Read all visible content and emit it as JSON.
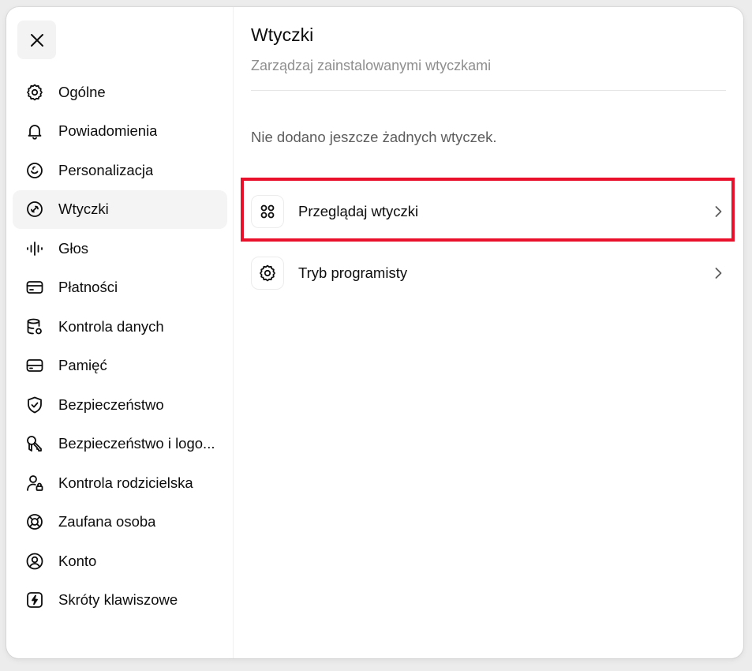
{
  "sidebar": {
    "close_icon": "close-icon",
    "items": [
      {
        "label": "Ogólne",
        "icon": "gear-icon"
      },
      {
        "label": "Powiadomienia",
        "icon": "bell-icon"
      },
      {
        "label": "Personalizacja",
        "icon": "smile-icon"
      },
      {
        "label": "Wtyczki",
        "icon": "plugin-icon",
        "active": true
      },
      {
        "label": "Głos",
        "icon": "voice-icon"
      },
      {
        "label": "Płatności",
        "icon": "card-icon"
      },
      {
        "label": "Kontrola danych",
        "icon": "database-icon"
      },
      {
        "label": "Pamięć",
        "icon": "memory-icon"
      },
      {
        "label": "Bezpieczeństwo",
        "icon": "shield-icon"
      },
      {
        "label": "Bezpieczeństwo i logo...",
        "icon": "key-icon"
      },
      {
        "label": "Kontrola rodzicielska",
        "icon": "parent-icon"
      },
      {
        "label": "Zaufana osoba",
        "icon": "lifebuoy-icon"
      },
      {
        "label": "Konto",
        "icon": "user-icon"
      },
      {
        "label": "Skróty klawiszowe",
        "icon": "bolt-icon"
      }
    ]
  },
  "main": {
    "title": "Wtyczki",
    "subtitle": "Zarządzaj zainstalowanymi wtyczkami",
    "empty_message": "Nie dodano jeszcze żadnych wtyczek.",
    "rows": [
      {
        "label": "Przeglądaj wtyczki",
        "icon": "apps-grid-icon",
        "highlighted": true
      },
      {
        "label": "Tryb programisty",
        "icon": "gear-icon"
      }
    ]
  },
  "colors": {
    "highlight": "#e8102b",
    "active_bg": "#f4f4f4",
    "subtitle": "#8f8f8f"
  }
}
